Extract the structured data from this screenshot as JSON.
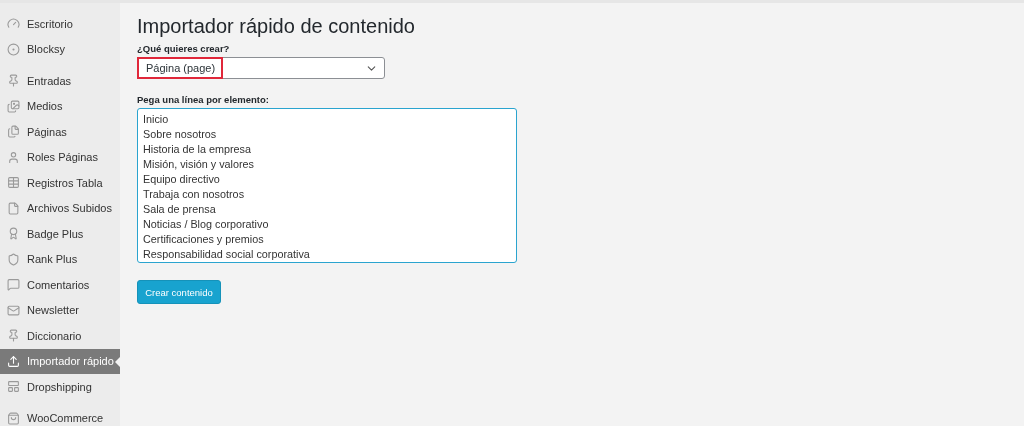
{
  "sidebar": {
    "groups": [
      {
        "items": [
          {
            "label": "Escritorio",
            "selected": false
          },
          {
            "label": "Blocksy",
            "selected": false
          }
        ]
      },
      {
        "items": [
          {
            "label": "Entradas",
            "selected": false
          },
          {
            "label": "Medios",
            "selected": false
          },
          {
            "label": "Páginas",
            "selected": false
          },
          {
            "label": "Roles Páginas",
            "selected": false
          },
          {
            "label": "Registros Tabla",
            "selected": false
          },
          {
            "label": "Archivos Subidos",
            "selected": false
          },
          {
            "label": "Badge Plus",
            "selected": false
          },
          {
            "label": "Rank Plus",
            "selected": false
          },
          {
            "label": "Comentarios",
            "selected": false
          },
          {
            "label": "Newsletter",
            "selected": false
          },
          {
            "label": "Diccionario",
            "selected": false
          },
          {
            "label": "Importador rápido",
            "selected": true
          },
          {
            "label": "Dropshipping",
            "selected": false
          }
        ]
      },
      {
        "items": [
          {
            "label": "WooCommerce",
            "selected": false
          }
        ]
      }
    ]
  },
  "page": {
    "title": "Importador rápido de contenido",
    "type_field": {
      "label": "¿Qué quieres crear?",
      "value": "Página (page)",
      "highlighted": true
    },
    "lines_field": {
      "label": "Pega una línea por elemento:",
      "lines": [
        "Inicio",
        "Sobre nosotros",
        "Historia de la empresa",
        "Misión, visión y valores",
        "Equipo directivo",
        "Trabaja con nosotros",
        "Sala de prensa",
        "Noticias / Blog corporativo",
        "Certificaciones y premios",
        "Responsabilidad social corporativa"
      ]
    },
    "submit_button": "Crear contenido"
  }
}
